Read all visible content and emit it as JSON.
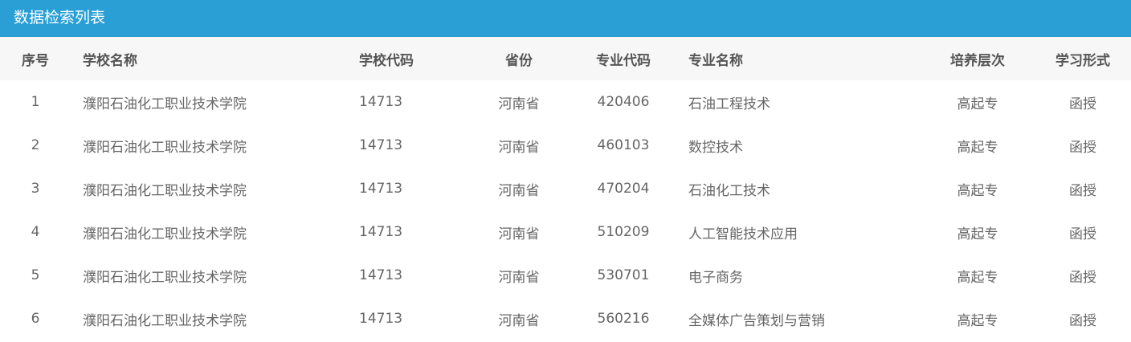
{
  "panel": {
    "title": "数据检索列表"
  },
  "table": {
    "headers": {
      "no": "序号",
      "school_name": "学校名称",
      "school_code": "学校代码",
      "province": "省份",
      "major_code": "专业代码",
      "major_name": "专业名称",
      "level": "培养层次",
      "study_form": "学习形式"
    },
    "rows": [
      {
        "no": "1",
        "school_name": "濮阳石油化工职业技术学院",
        "school_code": "14713",
        "province": "河南省",
        "major_code": "420406",
        "major_name": "石油工程技术",
        "level": "高起专",
        "study_form": "函授"
      },
      {
        "no": "2",
        "school_name": "濮阳石油化工职业技术学院",
        "school_code": "14713",
        "province": "河南省",
        "major_code": "460103",
        "major_name": "数控技术",
        "level": "高起专",
        "study_form": "函授"
      },
      {
        "no": "3",
        "school_name": "濮阳石油化工职业技术学院",
        "school_code": "14713",
        "province": "河南省",
        "major_code": "470204",
        "major_name": "石油化工技术",
        "level": "高起专",
        "study_form": "函授"
      },
      {
        "no": "4",
        "school_name": "濮阳石油化工职业技术学院",
        "school_code": "14713",
        "province": "河南省",
        "major_code": "510209",
        "major_name": "人工智能技术应用",
        "level": "高起专",
        "study_form": "函授"
      },
      {
        "no": "5",
        "school_name": "濮阳石油化工职业技术学院",
        "school_code": "14713",
        "province": "河南省",
        "major_code": "530701",
        "major_name": "电子商务",
        "level": "高起专",
        "study_form": "函授"
      },
      {
        "no": "6",
        "school_name": "濮阳石油化工职业技术学院",
        "school_code": "14713",
        "province": "河南省",
        "major_code": "560216",
        "major_name": "全媒体广告策划与营销",
        "level": "高起专",
        "study_form": "函授"
      }
    ]
  },
  "colors": {
    "header_bar": "#2a9fd6",
    "column_header_bg": "#f7f7f7",
    "text": "#666666"
  }
}
